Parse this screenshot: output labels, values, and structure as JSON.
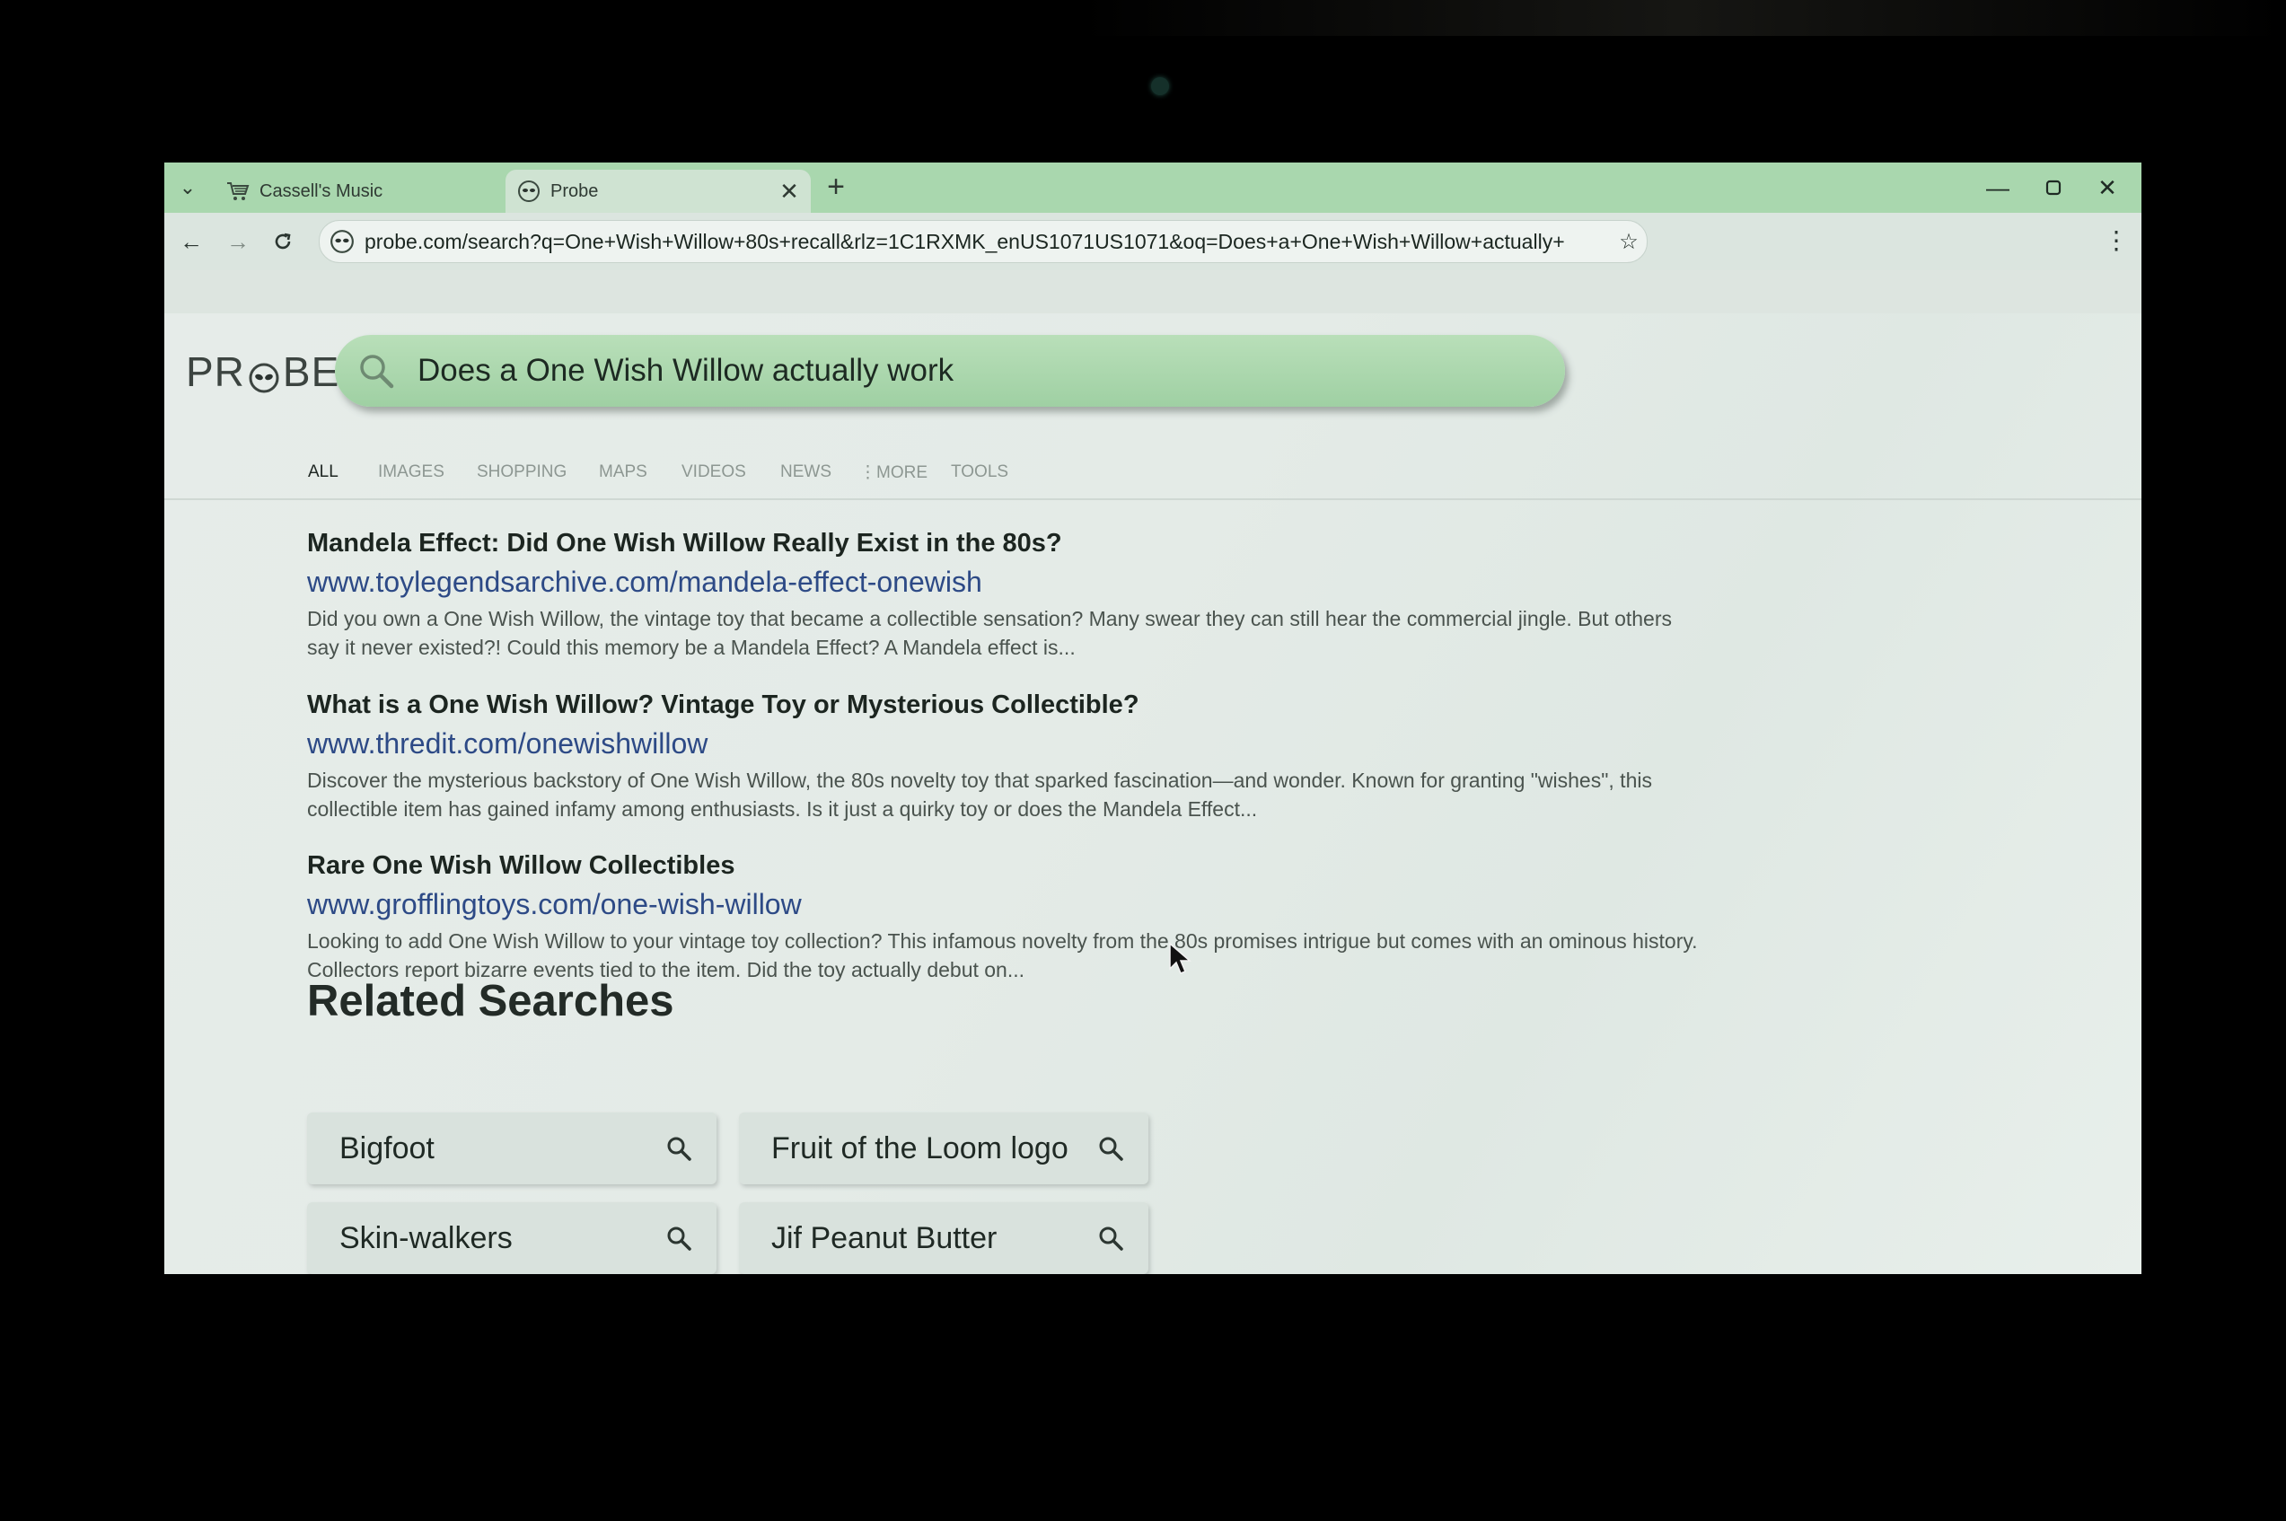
{
  "tabs": [
    {
      "title": "Cassell's Music",
      "icon": "cart-icon"
    },
    {
      "title": "Probe",
      "icon": "alien-face-icon",
      "active": true
    }
  ],
  "address_bar": {
    "url": "probe.com/search?q=One+Wish+Willow+80s+recall&rlz=1C1RXMK_enUS1071US1071&oq=Does+a+One+Wish+Willow+actually+"
  },
  "brand": {
    "logo_text_left": "PR",
    "logo_text_right": "BE",
    "accent": "#a3d3a6"
  },
  "search": {
    "query": "Does a One Wish Willow actually work"
  },
  "search_tabs": [
    "ALL",
    "IMAGES",
    "SHOPPING",
    "MAPS",
    "VIDEOS",
    "NEWS",
    "⋮MORE",
    "TOOLS"
  ],
  "results": [
    {
      "title": "Mandela Effect: Did One Wish Willow Really Exist in the 80s?",
      "url": "www.toylegendsarchive.com/mandela-effect-onewish",
      "snippet": "Did you own a One Wish Willow, the vintage toy that became a collectible sensation? Many swear they can still hear the commercial jingle. But others say it never existed?! Could this memory be a Mandela Effect? A Mandela effect is..."
    },
    {
      "title": "What is a One Wish Willow? Vintage Toy or Mysterious Collectible?",
      "url": "www.thredit.com/onewishwillow",
      "snippet": "Discover the mysterious backstory of One Wish Willow, the 80s novelty toy that sparked fascination—and wonder. Known for granting \"wishes\", this collectible item has gained infamy among enthusiasts. Is it just a quirky toy or does the Mandela Effect..."
    },
    {
      "title": "Rare One Wish Willow Collectibles",
      "url": "www.grofflingtoys.com/one-wish-willow",
      "snippet": "Looking to add One Wish Willow to your vintage toy collection? This infamous novelty from the 80s promises intrigue but comes with an ominous history. Collectors report bizarre events tied to the item. Did the toy actually debut on..."
    }
  ],
  "related": {
    "heading": "Related Searches",
    "items": [
      "Bigfoot",
      "Fruit of the Loom logo",
      "Skin-walkers",
      "Jif Peanut Butter"
    ]
  }
}
